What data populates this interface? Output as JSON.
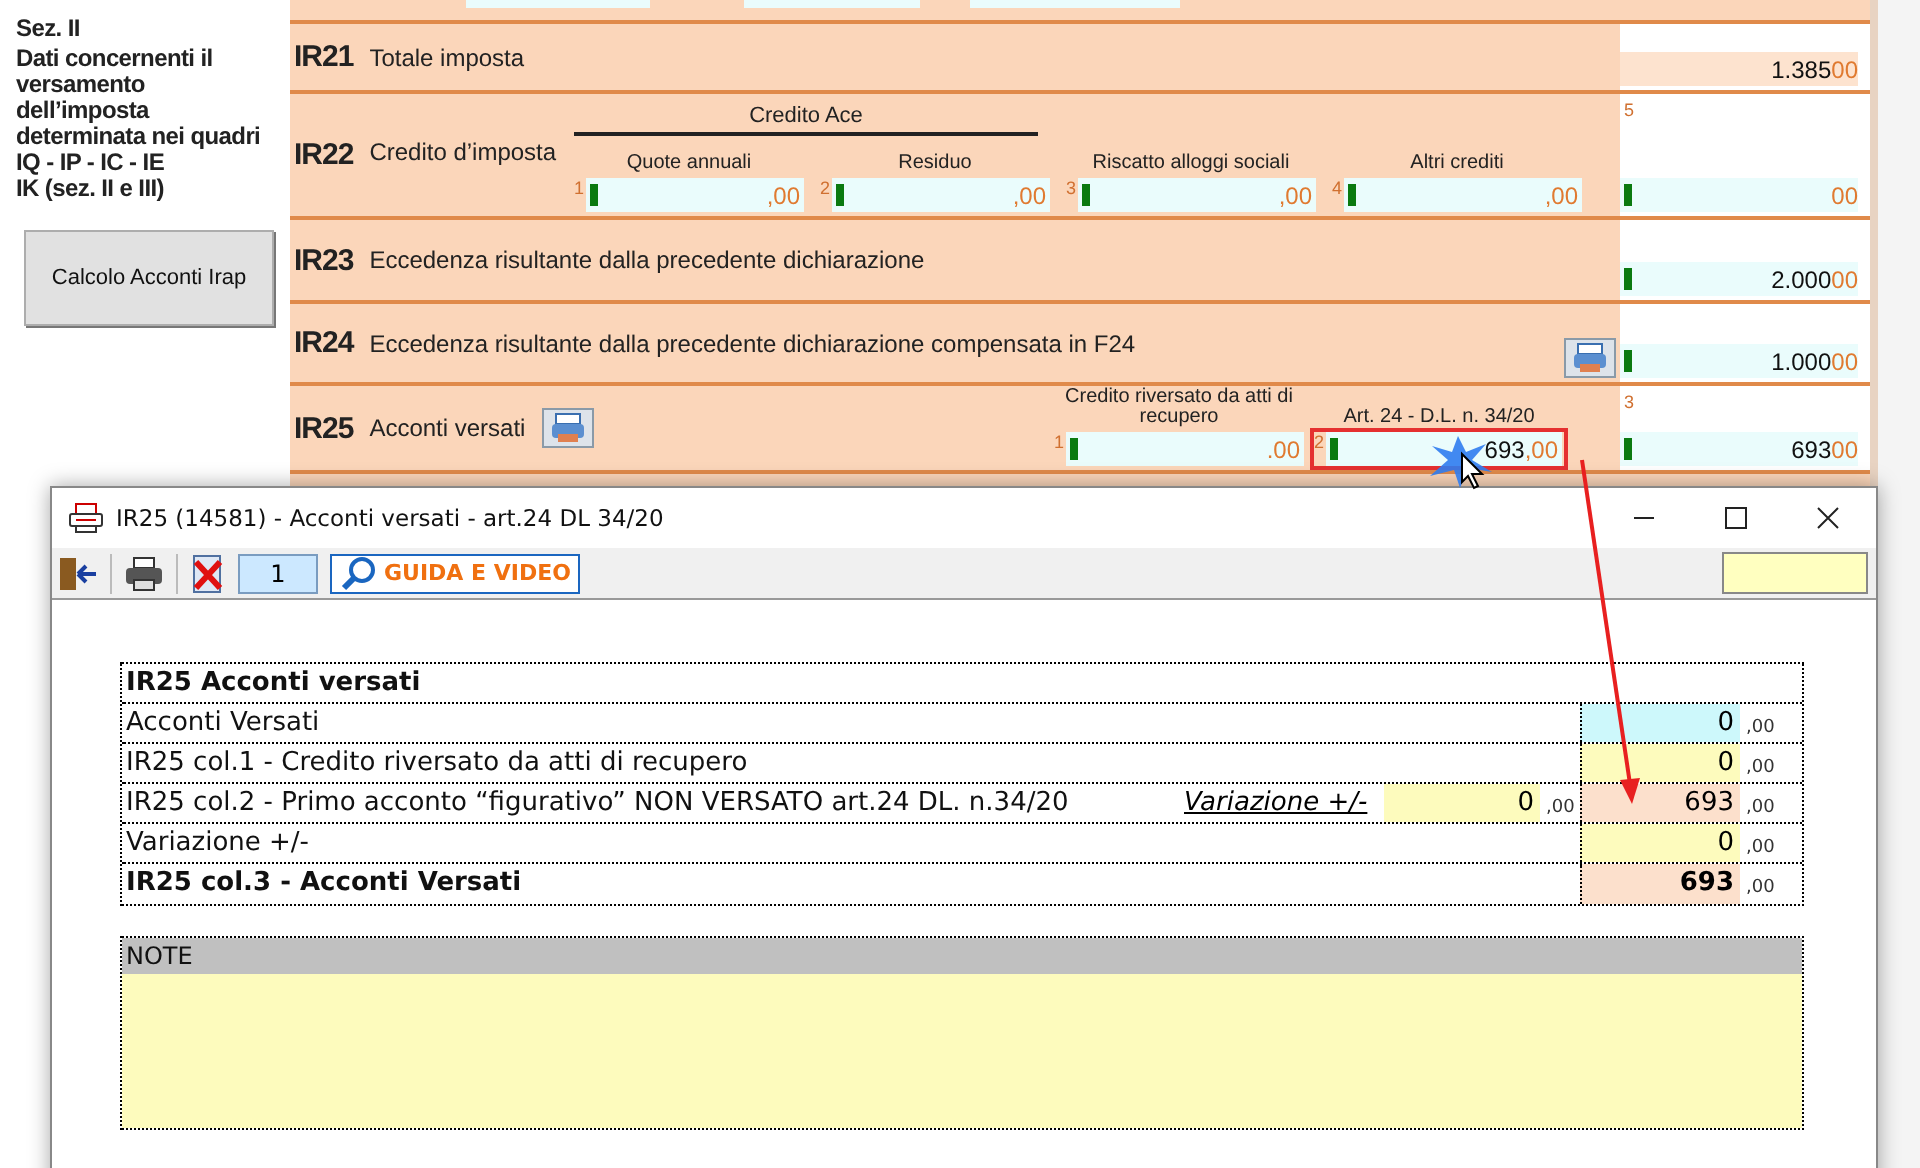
{
  "section": {
    "title": "Sez. II",
    "lines": [
      "Dati concernenti il",
      "versamento",
      "dell’imposta",
      "determinata nei quadri",
      "IQ - IP - IC - IE",
      "IK (sez. II e III)"
    ]
  },
  "calc_button": "Calcolo Acconti Irap",
  "rows": [
    {
      "code": "IR21",
      "label": "Totale imposta",
      "total": {
        "value": "1.385",
        "cents": "00",
        "computed": true
      }
    },
    {
      "code": "IR22",
      "label": "Credito d’imposta",
      "group": "Credito Ace",
      "columns": [
        {
          "heading": "Quote annuali",
          "number": "1",
          "cents": ",00"
        },
        {
          "heading": "Residuo",
          "number": "2",
          "cents": ",00"
        },
        {
          "heading": "Riscatto alloggi sociali",
          "number": "3",
          "cents": ",00"
        },
        {
          "heading": "Altri crediti",
          "number": "4",
          "cents": ",00"
        }
      ],
      "total": {
        "number": "5",
        "cents": "00",
        "computed": false
      }
    },
    {
      "code": "IR23",
      "label": "Eccedenza risultante dalla precedente dichiarazione",
      "total": {
        "value": "2.000",
        "cents": "00",
        "computed": false
      }
    },
    {
      "code": "IR24",
      "label": "Eccedenza risultante dalla precedente dichiarazione compensata in F24",
      "button_right": true,
      "total": {
        "value": "1.000",
        "cents": "00",
        "computed": false
      }
    },
    {
      "code": "IR25",
      "label": "Acconti versati",
      "button_inline": true,
      "columns": [
        {
          "heading": "Credito riversato da atti di recupero",
          "number": "1",
          "cents": ".00"
        },
        {
          "heading": "Art. 24 - D.L. n. 34/20",
          "number": "2",
          "value": "693",
          "cents": ",00",
          "highlighted": true
        }
      ],
      "total": {
        "number": "3",
        "value": "693",
        "cents": "00",
        "computed": false
      }
    }
  ],
  "dialog": {
    "title": "IR25 (14581) - Acconti versati - art.24 DL 34/20",
    "page": "1",
    "guide": "GUIDA E VIDEO",
    "heading": "IR25 Acconti versati",
    "lines": [
      {
        "label": "Acconti Versati",
        "value": "0",
        "cents": ",00",
        "kind": "imported",
        "bold": false
      },
      {
        "label": "IR25 col.1  - Credito riversato da atti di recupero",
        "value": "0",
        "cents": ",00",
        "kind": "editable",
        "bold": false
      },
      {
        "label": "IR25 col.2  - Primo acconto “figurativo” NON VERSATO art.24 DL. n.34/20",
        "value": "693",
        "cents": ",00",
        "kind": "calculated",
        "bold": false,
        "variation": {
          "label": "Variazione +/-",
          "value": "0",
          "cents": ",00"
        }
      },
      {
        "label": "Variazione +/-",
        "value": "0",
        "cents": ",00",
        "kind": "editable",
        "bold": false
      },
      {
        "label": "IR25 col.3 - Acconti Versati",
        "value": "693",
        "cents": ",00",
        "kind": "calculated",
        "bold": true
      }
    ],
    "note": "NOTE"
  }
}
